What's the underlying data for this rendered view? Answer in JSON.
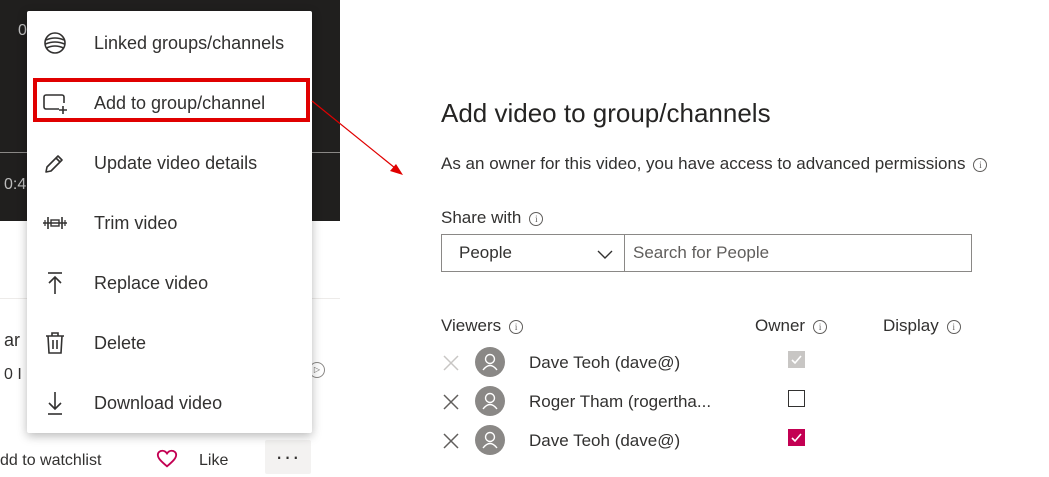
{
  "video": {
    "time_top": "0",
    "time_mid": "0:4",
    "cut_text_1": "ar",
    "cut_text_2": "0 I"
  },
  "actions": {
    "watchlist_label": "dd to watchlist",
    "like_label": "Like",
    "more_label": "···"
  },
  "menu": {
    "items": [
      {
        "label": "Linked groups/channels",
        "icon": "globe-icon"
      },
      {
        "label": "Add to group/channel",
        "icon": "add-to-group-icon"
      },
      {
        "label": "Update video details",
        "icon": "pencil-icon"
      },
      {
        "label": "Trim video",
        "icon": "trim-icon"
      },
      {
        "label": "Replace video",
        "icon": "upload-icon"
      },
      {
        "label": "Delete",
        "icon": "trash-icon"
      },
      {
        "label": "Download video",
        "icon": "download-icon"
      }
    ],
    "highlighted_index": 1,
    "highlight_color": "#e00000"
  },
  "panel": {
    "title": "Add video to group/channels",
    "description": "As an owner for this video, you have access to advanced permissions",
    "share_with_label": "Share with",
    "share_select_value": "People",
    "search_placeholder": "Search for People",
    "columns": {
      "viewers": "Viewers",
      "owner": "Owner",
      "display": "Display"
    },
    "rows": [
      {
        "name": "Dave Teoh (dave@)",
        "owner_state": "checked-disabled"
      },
      {
        "name": "Roger Tham (rogertha...",
        "owner_state": "unchecked"
      },
      {
        "name": "Dave Teoh (dave@)",
        "owner_state": "checked"
      }
    ],
    "accent_color": "#c30052"
  }
}
